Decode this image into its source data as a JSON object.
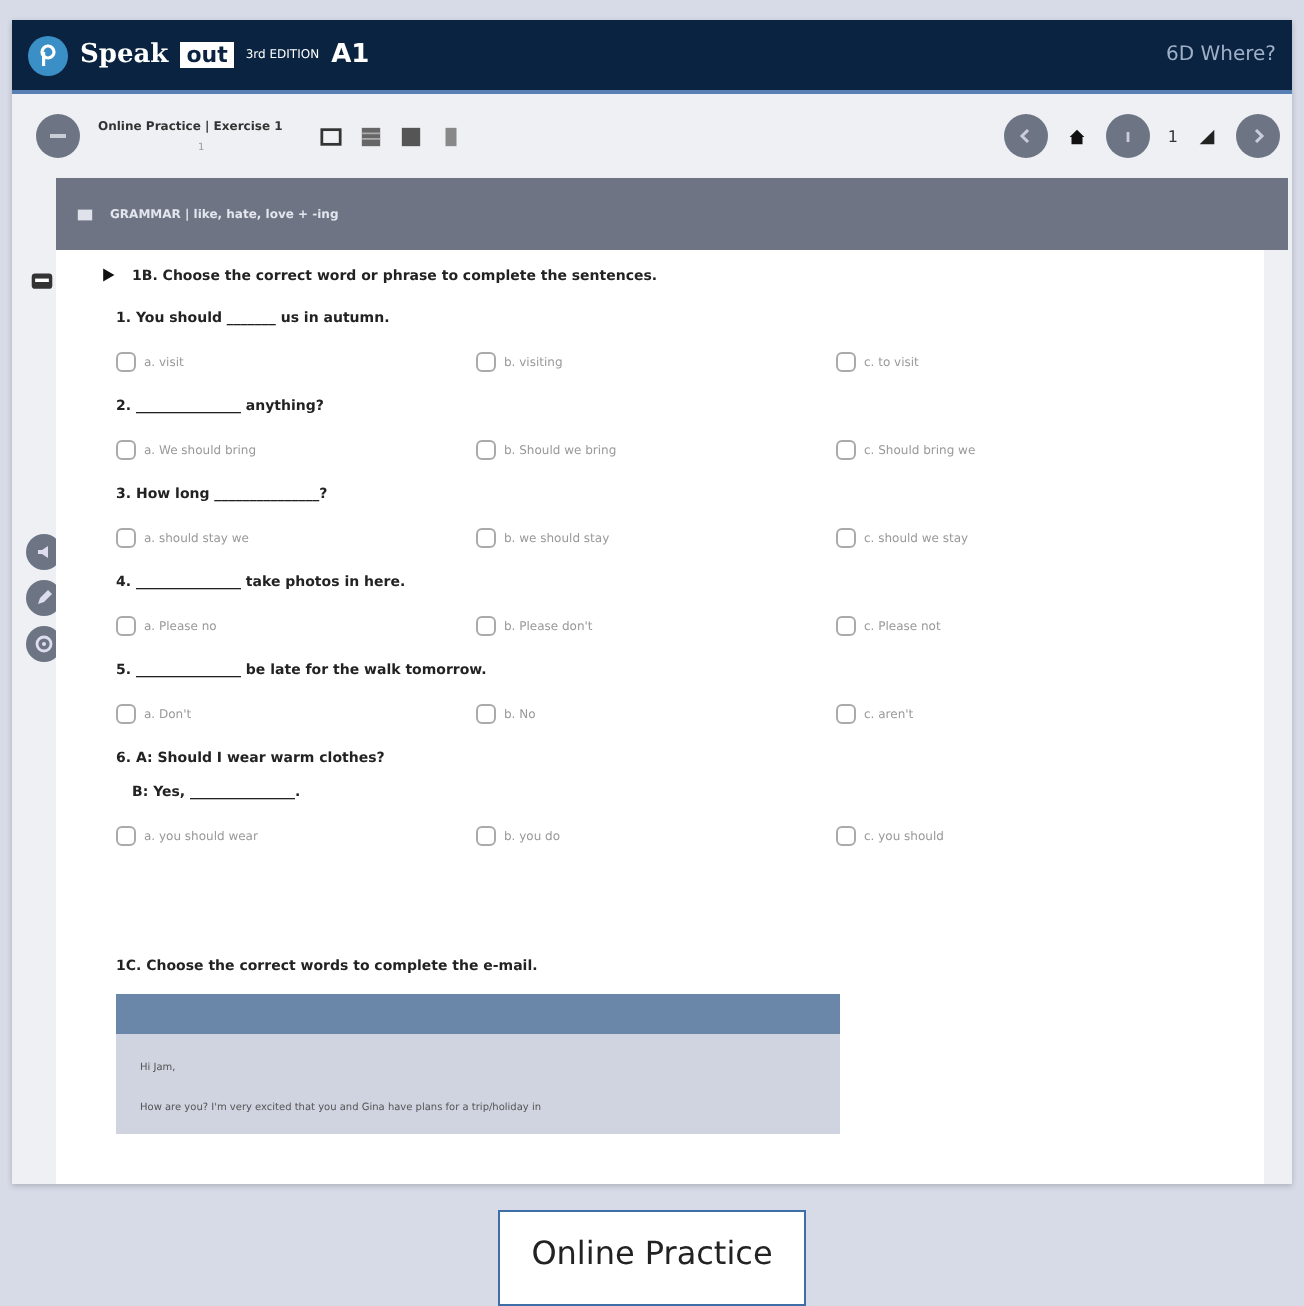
{
  "header": {
    "brand": "Speak",
    "brand_badge": "out",
    "edition": "3rd EDITION",
    "level": "A1",
    "unit": "6D Where?"
  },
  "toolbar": {
    "title": "Online Practice | Exercise 1",
    "page": "1",
    "nav_page": "1"
  },
  "banner": {
    "title": "GRAMMAR | like, hate, love + -ing"
  },
  "exercise": {
    "instruction": "1B. Choose the correct word or phrase to complete the sentences.",
    "questions": [
      {
        "lines": [
          "1. You should _______ us in autumn."
        ],
        "options": [
          {
            "label": "a. visit",
            "selected": false
          },
          {
            "label": "b. visiting",
            "selected": false
          },
          {
            "label": "c. to visit",
            "selected": false
          }
        ]
      },
      {
        "lines": [
          "2. _______________ anything?"
        ],
        "options": [
          {
            "label": "a. We should bring",
            "selected": false
          },
          {
            "label": "b. Should we bring",
            "selected": false
          },
          {
            "label": "c. Should bring we",
            "selected": false
          }
        ]
      },
      {
        "lines": [
          "3. How long _______________?"
        ],
        "options": [
          {
            "label": "a. should stay we",
            "selected": false
          },
          {
            "label": "b. we should stay",
            "selected": false
          },
          {
            "label": "c. should we stay",
            "selected": false
          }
        ]
      },
      {
        "lines": [
          "4. _______________ take photos in here."
        ],
        "options": [
          {
            "label": "a. Please no",
            "selected": false
          },
          {
            "label": "b. Please don't",
            "selected": false
          },
          {
            "label": "c. Please not",
            "selected": false
          }
        ]
      },
      {
        "lines": [
          "5. _______________ be late for the walk tomorrow."
        ],
        "options": [
          {
            "label": "a. Don't",
            "selected": false
          },
          {
            "label": "b. No",
            "selected": false
          },
          {
            "label": "c. aren't",
            "selected": false
          }
        ]
      },
      {
        "lines": [
          "6. A: Should I wear warm clothes?",
          "B: Yes, _______________."
        ],
        "options": [
          {
            "label": "a. you should wear",
            "selected": false
          },
          {
            "label": "b. you do",
            "selected": false
          },
          {
            "label": "c. you should",
            "selected": false
          }
        ]
      }
    ]
  },
  "exercise2": {
    "instruction": "1C. Choose the correct words to complete the e-mail.",
    "email_lines": [
      "Hi Jam,",
      "How are you? I'm very excited that you and Gina have plans for a trip/holiday in"
    ]
  },
  "caption": "Online Practice"
}
